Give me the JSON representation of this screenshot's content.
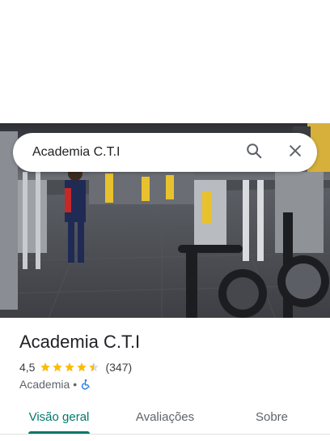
{
  "search": {
    "query": "Academia C.T.I"
  },
  "place": {
    "title": "Academia C.T.I",
    "rating": "4,5",
    "rating_stars_value": 4.5,
    "review_count": "(347)",
    "category": "Academia",
    "separator": "•",
    "wheelchair_accessible": true
  },
  "tabs": [
    {
      "label": "Visão geral",
      "active": true
    },
    {
      "label": "Avaliações",
      "active": false
    },
    {
      "label": "Sobre",
      "active": false
    }
  ],
  "colors": {
    "accent": "#00796b",
    "star": "#fbbc04",
    "access_icon": "#1a73e8"
  },
  "icons": {
    "search": "search-icon",
    "close": "close-icon",
    "accessible": "wheelchair-icon",
    "star": "star-icon"
  }
}
